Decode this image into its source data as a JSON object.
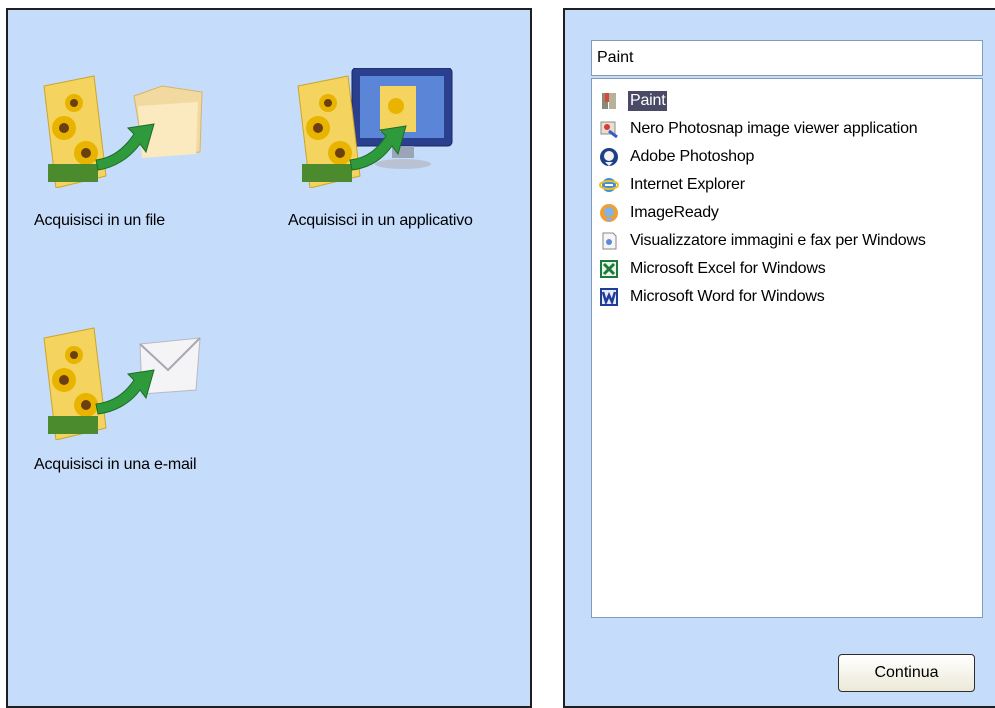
{
  "actions": [
    {
      "label": "Acquisisci in un file",
      "icon": "acquire-to-file-icon"
    },
    {
      "label": "Acquisisci in un applicativo",
      "icon": "acquire-to-application-icon"
    },
    {
      "label": "Acquisisci in una e-mail",
      "icon": "acquire-to-email-icon"
    }
  ],
  "app_picker": {
    "selected_value": "Paint",
    "items": [
      {
        "label": "Paint",
        "icon": "paint-icon",
        "selected": true
      },
      {
        "label": "Nero Photosnap image viewer application",
        "icon": "nero-photosnap-icon"
      },
      {
        "label": "Adobe Photoshop",
        "icon": "photoshop-icon"
      },
      {
        "label": "Internet Explorer",
        "icon": "internet-explorer-icon"
      },
      {
        "label": "ImageReady",
        "icon": "imageready-icon"
      },
      {
        "label": "Visualizzatore immagini e fax per Windows",
        "icon": "image-fax-viewer-icon"
      },
      {
        "label": "Microsoft Excel for Windows",
        "icon": "excel-icon"
      },
      {
        "label": "Microsoft Word for Windows",
        "icon": "word-icon"
      }
    ]
  },
  "continue_label": "Continua",
  "colors": {
    "panel_bg": "#c6dcfb",
    "selection": "#4a4a66",
    "arrow": "#2e9a3c"
  }
}
